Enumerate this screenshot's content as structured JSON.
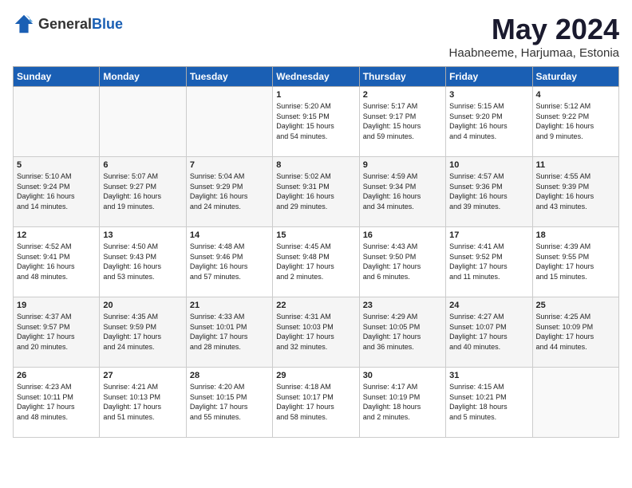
{
  "header": {
    "logo_general": "General",
    "logo_blue": "Blue",
    "month_year": "May 2024",
    "location": "Haabneeme, Harjumaa, Estonia"
  },
  "weekdays": [
    "Sunday",
    "Monday",
    "Tuesday",
    "Wednesday",
    "Thursday",
    "Friday",
    "Saturday"
  ],
  "weeks": [
    [
      {
        "day": "",
        "info": ""
      },
      {
        "day": "",
        "info": ""
      },
      {
        "day": "",
        "info": ""
      },
      {
        "day": "1",
        "info": "Sunrise: 5:20 AM\nSunset: 9:15 PM\nDaylight: 15 hours\nand 54 minutes."
      },
      {
        "day": "2",
        "info": "Sunrise: 5:17 AM\nSunset: 9:17 PM\nDaylight: 15 hours\nand 59 minutes."
      },
      {
        "day": "3",
        "info": "Sunrise: 5:15 AM\nSunset: 9:20 PM\nDaylight: 16 hours\nand 4 minutes."
      },
      {
        "day": "4",
        "info": "Sunrise: 5:12 AM\nSunset: 9:22 PM\nDaylight: 16 hours\nand 9 minutes."
      }
    ],
    [
      {
        "day": "5",
        "info": "Sunrise: 5:10 AM\nSunset: 9:24 PM\nDaylight: 16 hours\nand 14 minutes."
      },
      {
        "day": "6",
        "info": "Sunrise: 5:07 AM\nSunset: 9:27 PM\nDaylight: 16 hours\nand 19 minutes."
      },
      {
        "day": "7",
        "info": "Sunrise: 5:04 AM\nSunset: 9:29 PM\nDaylight: 16 hours\nand 24 minutes."
      },
      {
        "day": "8",
        "info": "Sunrise: 5:02 AM\nSunset: 9:31 PM\nDaylight: 16 hours\nand 29 minutes."
      },
      {
        "day": "9",
        "info": "Sunrise: 4:59 AM\nSunset: 9:34 PM\nDaylight: 16 hours\nand 34 minutes."
      },
      {
        "day": "10",
        "info": "Sunrise: 4:57 AM\nSunset: 9:36 PM\nDaylight: 16 hours\nand 39 minutes."
      },
      {
        "day": "11",
        "info": "Sunrise: 4:55 AM\nSunset: 9:39 PM\nDaylight: 16 hours\nand 43 minutes."
      }
    ],
    [
      {
        "day": "12",
        "info": "Sunrise: 4:52 AM\nSunset: 9:41 PM\nDaylight: 16 hours\nand 48 minutes."
      },
      {
        "day": "13",
        "info": "Sunrise: 4:50 AM\nSunset: 9:43 PM\nDaylight: 16 hours\nand 53 minutes."
      },
      {
        "day": "14",
        "info": "Sunrise: 4:48 AM\nSunset: 9:46 PM\nDaylight: 16 hours\nand 57 minutes."
      },
      {
        "day": "15",
        "info": "Sunrise: 4:45 AM\nSunset: 9:48 PM\nDaylight: 17 hours\nand 2 minutes."
      },
      {
        "day": "16",
        "info": "Sunrise: 4:43 AM\nSunset: 9:50 PM\nDaylight: 17 hours\nand 6 minutes."
      },
      {
        "day": "17",
        "info": "Sunrise: 4:41 AM\nSunset: 9:52 PM\nDaylight: 17 hours\nand 11 minutes."
      },
      {
        "day": "18",
        "info": "Sunrise: 4:39 AM\nSunset: 9:55 PM\nDaylight: 17 hours\nand 15 minutes."
      }
    ],
    [
      {
        "day": "19",
        "info": "Sunrise: 4:37 AM\nSunset: 9:57 PM\nDaylight: 17 hours\nand 20 minutes."
      },
      {
        "day": "20",
        "info": "Sunrise: 4:35 AM\nSunset: 9:59 PM\nDaylight: 17 hours\nand 24 minutes."
      },
      {
        "day": "21",
        "info": "Sunrise: 4:33 AM\nSunset: 10:01 PM\nDaylight: 17 hours\nand 28 minutes."
      },
      {
        "day": "22",
        "info": "Sunrise: 4:31 AM\nSunset: 10:03 PM\nDaylight: 17 hours\nand 32 minutes."
      },
      {
        "day": "23",
        "info": "Sunrise: 4:29 AM\nSunset: 10:05 PM\nDaylight: 17 hours\nand 36 minutes."
      },
      {
        "day": "24",
        "info": "Sunrise: 4:27 AM\nSunset: 10:07 PM\nDaylight: 17 hours\nand 40 minutes."
      },
      {
        "day": "25",
        "info": "Sunrise: 4:25 AM\nSunset: 10:09 PM\nDaylight: 17 hours\nand 44 minutes."
      }
    ],
    [
      {
        "day": "26",
        "info": "Sunrise: 4:23 AM\nSunset: 10:11 PM\nDaylight: 17 hours\nand 48 minutes."
      },
      {
        "day": "27",
        "info": "Sunrise: 4:21 AM\nSunset: 10:13 PM\nDaylight: 17 hours\nand 51 minutes."
      },
      {
        "day": "28",
        "info": "Sunrise: 4:20 AM\nSunset: 10:15 PM\nDaylight: 17 hours\nand 55 minutes."
      },
      {
        "day": "29",
        "info": "Sunrise: 4:18 AM\nSunset: 10:17 PM\nDaylight: 17 hours\nand 58 minutes."
      },
      {
        "day": "30",
        "info": "Sunrise: 4:17 AM\nSunset: 10:19 PM\nDaylight: 18 hours\nand 2 minutes."
      },
      {
        "day": "31",
        "info": "Sunrise: 4:15 AM\nSunset: 10:21 PM\nDaylight: 18 hours\nand 5 minutes."
      },
      {
        "day": "",
        "info": ""
      }
    ]
  ]
}
